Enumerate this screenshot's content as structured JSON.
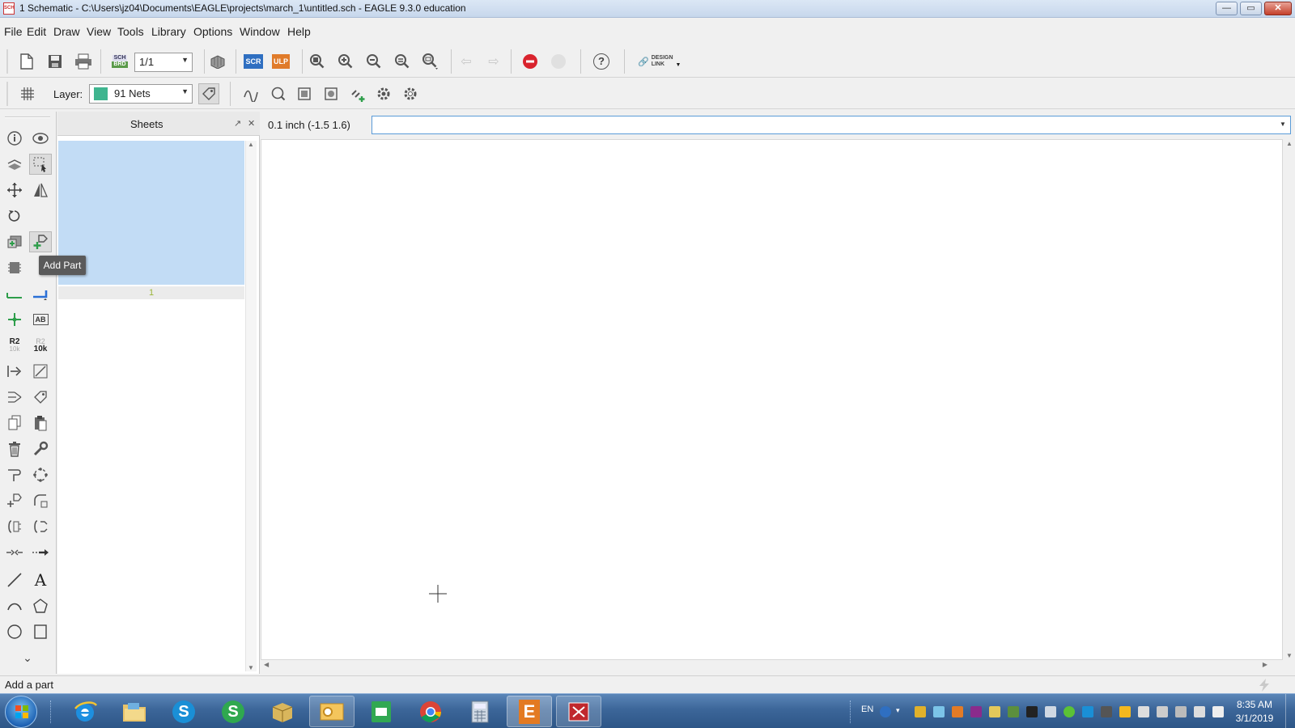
{
  "window": {
    "title": "1 Schematic - C:\\Users\\jz04\\Documents\\EAGLE\\projects\\march_1\\untitled.sch - EAGLE 9.3.0 education",
    "app_icon_text": "SCH",
    "controls": {
      "minimize": "—",
      "maximize": "▭",
      "close": "✕"
    }
  },
  "menu": {
    "items": [
      "File",
      "Edit",
      "Draw",
      "View",
      "Tools",
      "Library",
      "Options",
      "Window",
      "Help"
    ]
  },
  "toolbar1": {
    "sheet_select_value": "1/1",
    "scr_label": "SCR",
    "ulp_label": "ULP",
    "sch_brd_top": "SCH",
    "sch_brd_bottom": "BRD",
    "design_link_top": "DESIGN",
    "design_link_bottom": "LINK",
    "help_label": "?"
  },
  "toolbar2": {
    "layer_label": "Layer:",
    "layer_value": "91 Nets",
    "layer_color": "#3fb58f"
  },
  "sheets_panel": {
    "title": "Sheets",
    "pin_icon": "↗",
    "close_icon": "✕",
    "sheet_number": "1"
  },
  "palette": {
    "tooltip": "Add Part",
    "name_label_top": "R2",
    "name_label_bottom": "10k",
    "value_label_top": "R2",
    "value_label_bottom": "10k",
    "text_tool": "A",
    "label_tool": "AB",
    "more": "⌄"
  },
  "coords": {
    "grid_readout": "0.1 inch (-1.5 1.6)",
    "command_placeholder": ""
  },
  "status": {
    "message": "Add a part"
  },
  "taskbar": {
    "language": "EN",
    "time": "8:35 AM",
    "date": "3/1/2019",
    "skype_label": "S",
    "spreadsheet_label": "S",
    "eagle_label": "E"
  },
  "colors": {
    "accent": "#5a9bd8",
    "sheet_selected": "#c2dcf5",
    "stop_button": "#d9232d",
    "net_green": "#2e9e4b",
    "bus_blue": "#2a6fd6"
  }
}
